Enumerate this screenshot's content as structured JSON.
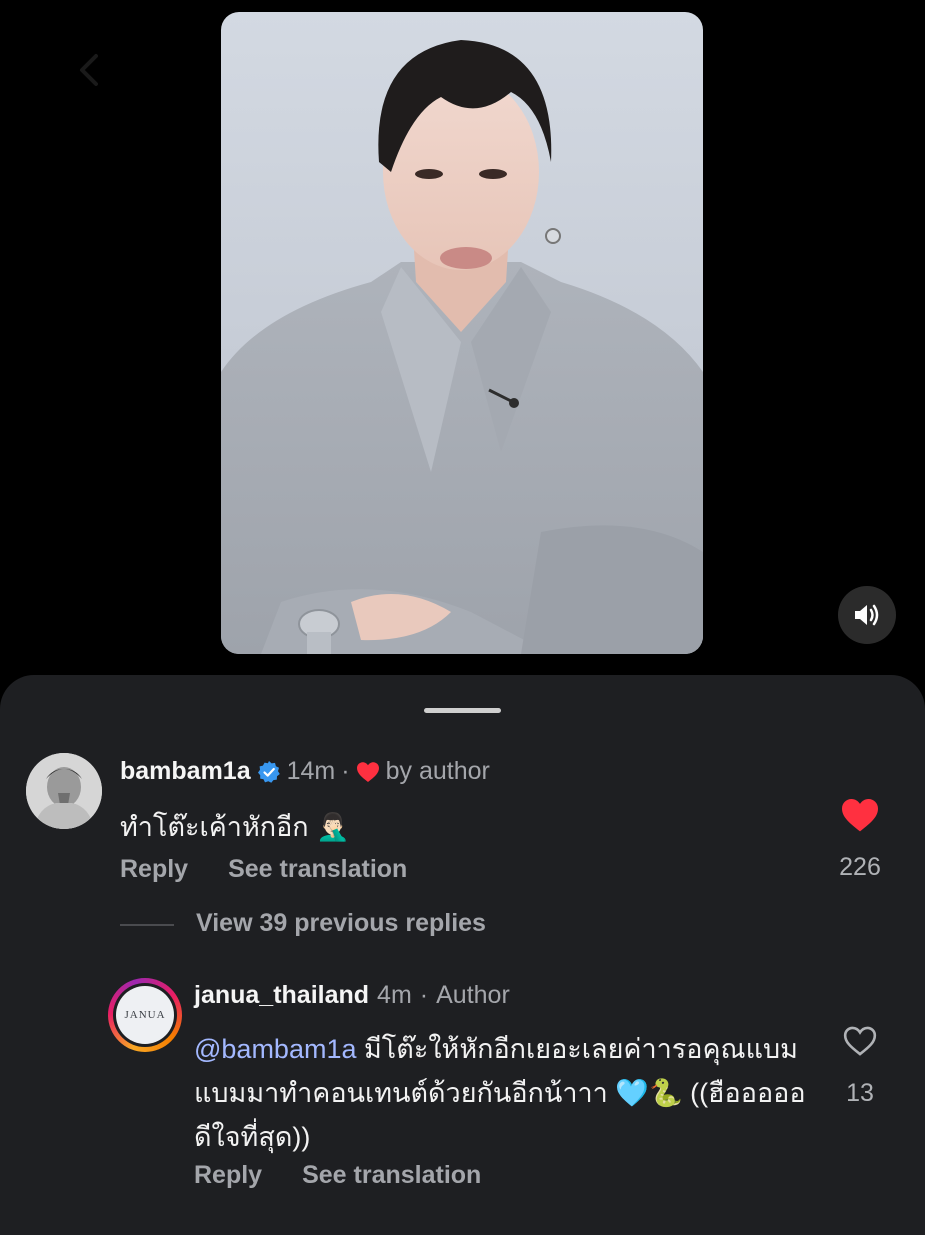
{
  "colors": {
    "background": "#000000",
    "sheet": "#1e1f22",
    "muted_text": "#a4a6ab",
    "mention": "#a3b8ff",
    "heart_red": "#ff3040",
    "verified_blue": "#3897f0"
  },
  "comment": {
    "username": "bambam1a",
    "verified": true,
    "time": "14m",
    "separator": "·",
    "liked_by_author": "by author",
    "text": "ทำโต๊ะเค้าหักอีก",
    "emoji": "🤦🏻‍♂️",
    "reply_label": "Reply",
    "translate_label": "See translation",
    "like_count": "226",
    "liked": true
  },
  "view_replies_label": "View 39 previous replies",
  "reply": {
    "username": "janua_thailand",
    "avatar_text": "JANUA",
    "time": "4m",
    "separator": "·",
    "author_tag": "Author",
    "mention": "@bambam1a",
    "text": " มีโต๊ะให้หักอีกเยอะเลยค่าารอคุณแบมแบมมาทำคอนเทนต์ด้วยกันอีกน้าาา 🩵🐍 ((ฮือออออ ดีใจที่สุด))",
    "reply_label": "Reply",
    "translate_label": "See translation",
    "like_count": "13",
    "liked": false
  },
  "icons": {
    "back": "chevron-left-icon",
    "sound": "speaker-icon",
    "verified": "verified-badge-icon",
    "heart": "heart-icon"
  }
}
